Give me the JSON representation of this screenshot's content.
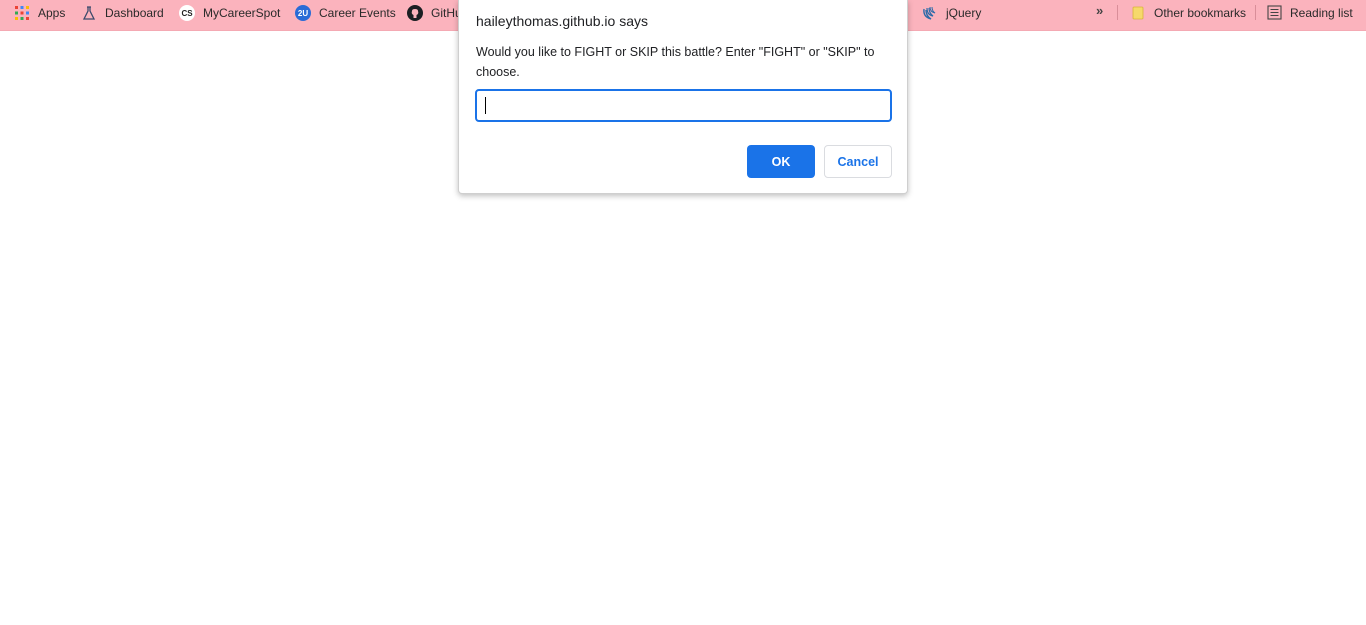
{
  "bookmarks_bar": {
    "items": [
      {
        "label": "Apps",
        "icon": "apps-grid-icon"
      },
      {
        "label": "Dashboard",
        "icon": "dashboard-flask-icon"
      },
      {
        "label": "MyCareerSpot",
        "icon": "cs-logo-icon",
        "icon_text": "CS"
      },
      {
        "label": "Career Events",
        "icon": "2u-logo-icon",
        "icon_text": "2U"
      },
      {
        "label": "GitHu",
        "icon": "github-icon"
      },
      {
        "label": "jQuery",
        "icon": "jquery-icon"
      }
    ],
    "overflow_symbol": "»",
    "other_bookmarks": {
      "label": "Other bookmarks",
      "icon": "folder-icon"
    },
    "reading_list": {
      "label": "Reading list",
      "icon": "reading-list-icon"
    },
    "background_color": "#fbb3bd"
  },
  "dialog": {
    "title": "haileythomas.github.io says",
    "message": "Would you like to FIGHT or SKIP this battle? Enter \"FIGHT\" or \"SKIP\" to choose.",
    "input_value": "",
    "ok_label": "OK",
    "cancel_label": "Cancel",
    "accent_color": "#1a73e8"
  }
}
